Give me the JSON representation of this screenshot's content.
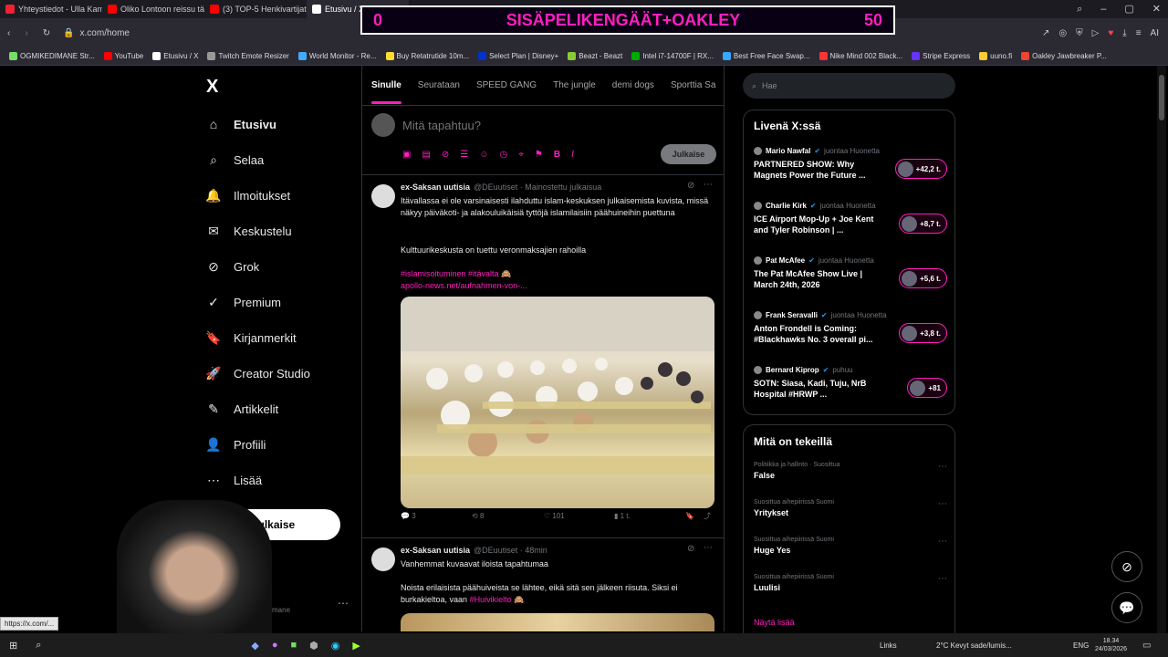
{
  "browser": {
    "tabs": [
      {
        "label": "Yhteystiedot - Ulla Kampp",
        "color": "#e23"
      },
      {
        "label": "Oliko Lontoon reissu täys",
        "color": "#f00"
      },
      {
        "label": "(3) TOP-5 Henkivartijat U",
        "color": "#f00"
      },
      {
        "label": "Etusivu / X",
        "color": "#fff"
      }
    ],
    "url": "x.com/home",
    "bookmarks": [
      "OGMIKEDIMANE Str...",
      "YouTube",
      "Etusivu / X",
      "Twitch Emote Resizer",
      "World Monitor - Re...",
      "Buy Retatrutide 10m...",
      "Select Plan | Disney+",
      "Beazt - Beazt",
      "Intel i7-14700F | RX...",
      "Best Free Face Swap...",
      "Nike Mind 002 Black...",
      "Stripe Express",
      "uuno.fi",
      "Oakley Jawbreaker P..."
    ],
    "ai_label": "AI"
  },
  "overlay": {
    "left": "0",
    "title": "SISÄPELIKENGÄÄT+OAKLEY",
    "right": "50"
  },
  "nav": {
    "logo": "X",
    "items": [
      {
        "label": "Etusivu",
        "icon": "home-icon",
        "glyph": "⌂"
      },
      {
        "label": "Selaa",
        "icon": "search-icon",
        "glyph": "⌕"
      },
      {
        "label": "Ilmoitukset",
        "icon": "bell-icon",
        "glyph": "🔔"
      },
      {
        "label": "Keskustelu",
        "icon": "mail-icon",
        "glyph": "✉"
      },
      {
        "label": "Grok",
        "icon": "grok-icon",
        "glyph": "⊘"
      },
      {
        "label": "Premium",
        "icon": "verified-icon",
        "glyph": "✓"
      },
      {
        "label": "Kirjanmerkit",
        "icon": "bookmark-icon",
        "glyph": "🔖"
      },
      {
        "label": "Creator Studio",
        "icon": "rocket-icon",
        "glyph": "🚀"
      },
      {
        "label": "Artikkelit",
        "icon": "article-icon",
        "glyph": "✎"
      },
      {
        "label": "Profiili",
        "icon": "person-icon",
        "glyph": "👤"
      },
      {
        "label": "Lisää",
        "icon": "more-icon",
        "glyph": "⋯"
      }
    ],
    "post_button": "Julkaise",
    "account_handle": "mane",
    "status_url": "https://x.com/..."
  },
  "feed": {
    "tabs": [
      "Sinulle",
      "Seurataan",
      "SPEED GANG",
      "The jungle",
      "demi dogs",
      "Sporttia Sa"
    ],
    "compose_placeholder": "Mitä tapahtuu?",
    "compose_button": "Julkaise",
    "tweets": [
      {
        "name": "ex-Saksan uutisia",
        "meta": "@DEuutiset · Mainostettu julkaisua",
        "text1": "Itävallassa ei ole varsinaisesti ilahduttu islam-keskuksen julkaisemista kuvista, missä näkyy päiväkoti- ja alakouluikäisiä tyttöjä islamilaisiin päähuineihin puettuna",
        "text2": "Kulttuurikeskusta on tuettu veronmaksajien rahoilla",
        "tags": "#islamisoituminen #itävalta 🙈",
        "link": "apollo-news.net/aufnahmen-von-...",
        "replies": "3",
        "reposts": "8",
        "likes": "101",
        "views": "1 t."
      },
      {
        "name": "ex-Saksan uutisia",
        "meta": "@DEuutiset · 48min",
        "text1": "Vanhemmat kuvaavat iloista tapahtumaa",
        "text2": "Noista erilaisista päähuiveista se lähtee, eikä sitä sen jälkeen riisuta. Siksi ei burkakieltoa, vaan",
        "tag": "#Huivikielto 🙈"
      }
    ]
  },
  "sidebar": {
    "search_placeholder": "Hae",
    "live_title": "Livenä X:ssä",
    "live": [
      {
        "host": "Mario Nawfal",
        "status": "juontaa Huonetta",
        "title": "PARTNERED SHOW: Why Magnets Power the Future ...",
        "count": "+42,2 t."
      },
      {
        "host": "Charlie Kirk",
        "status": "juontaa Huonetta",
        "title": "ICE Airport Mop-Up + Joe Kent and Tyler Robinson | ...",
        "count": "+8,7 t."
      },
      {
        "host": "Pat McAfee",
        "status": "juontaa Huonetta",
        "title": "The Pat McAfee Show Live | March 24th, 2026",
        "count": "+5,6 t."
      },
      {
        "host": "Frank Seravalli",
        "status": "juontaa Huonetta",
        "title": "Anton Frondell is Coming: #Blackhawks No. 3 overall pi...",
        "count": "+3,8 t."
      },
      {
        "host": "Bernard Kiprop",
        "status": "puhuu",
        "title": "SOTN: Siasa, Kadi, Tuju, NrB Hospital #HRWP ...",
        "count": "+81"
      }
    ],
    "trends_title": "Mitä on tekeillä",
    "trends": [
      {
        "context": "Politiikka ja hallinto · Suosittua",
        "name": "False"
      },
      {
        "context": "Suosittua aihepiirissä Suomi",
        "name": "Yritykset"
      },
      {
        "context": "Suosittua aihepiirissä Suomi",
        "name": "Huge Yes"
      },
      {
        "context": "Suosittua aihepiirissä Suomi",
        "name": "Luulisi"
      }
    ],
    "show_more": "Näytä lisää"
  },
  "taskbar": {
    "links": "Links",
    "weather": "2°C Kevyt sade/lumis...",
    "lang": "ENG",
    "time": "18.34",
    "date": "24/03/2026"
  }
}
